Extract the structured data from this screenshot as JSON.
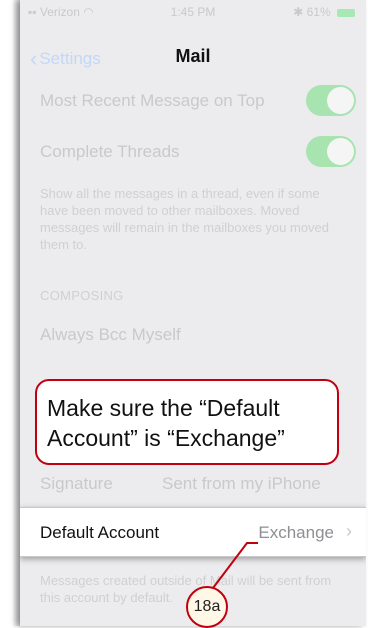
{
  "status": {
    "carrier": "Verizon",
    "time": "1:45 PM",
    "battery": "61%"
  },
  "nav": {
    "back_label": "Settings",
    "title": "Mail"
  },
  "rows": {
    "most_recent": "Most Recent Message on Top",
    "complete_threads": "Complete Threads",
    "threads_note": "Show all the messages in a thread, even if some have been moved to other mailboxes. Moved messages will remain in the mailboxes you moved them to.",
    "composing_header": "COMPOSING",
    "always_bcc": "Always Bcc Myself",
    "signature": "Signature",
    "signature_value": "Sent from my iPhone",
    "default_note": "Messages created outside of Mail will be sent from this account by default."
  },
  "default_account": {
    "label": "Default Account",
    "value": "Exchange"
  },
  "callout": {
    "text": "Make sure the “Default Account” is “Exchange”"
  },
  "marker": {
    "label": "18a"
  },
  "colors": {
    "toggle_on": "#a7e4b0",
    "callout_border": "#c0000f",
    "back_link": "#c3d7f7"
  }
}
